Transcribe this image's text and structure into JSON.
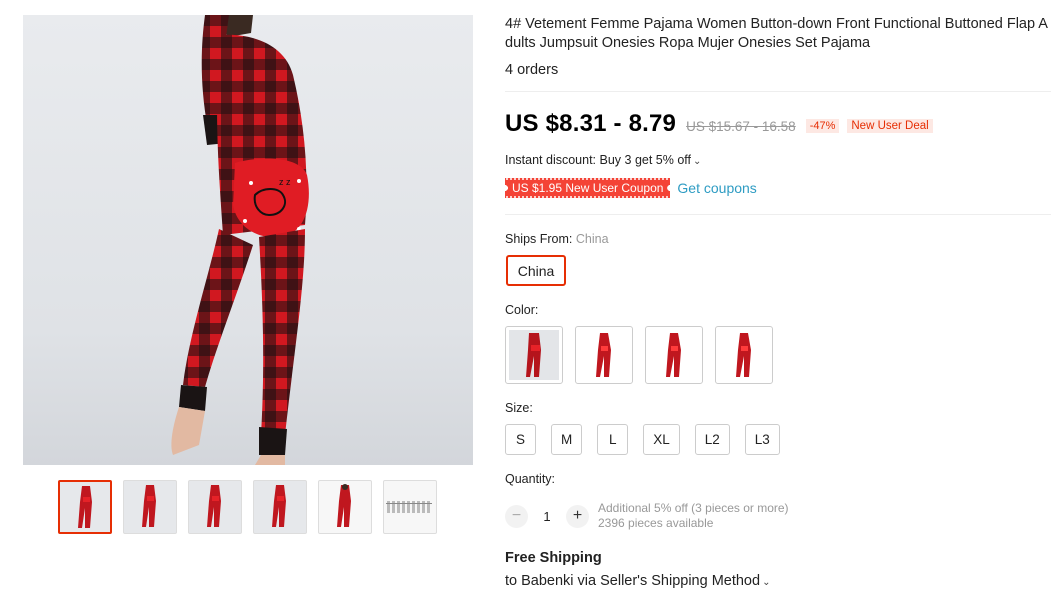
{
  "product": {
    "title": "4# Vetement Femme Pajama Women Button-down Front Functional Buttoned Flap A\ndults Jumpsuit Onesies Ropa Mujer Onesies Set Pajama",
    "orders": "4 orders"
  },
  "pricing": {
    "price": "US $8.31 - 8.79",
    "original": "US $15.67 - 16.58",
    "discount": "-47%",
    "deal": "New User Deal",
    "instant_discount": "Instant discount: Buy 3 get 5% off"
  },
  "coupon": {
    "label": "US $1.95 New User Coupon",
    "link": "Get coupons"
  },
  "ships_from": {
    "label": "Ships From:",
    "value": "China",
    "option": "China"
  },
  "color": {
    "label": "Color:",
    "options": [
      "pajama-back-gray",
      "pajama-front-1",
      "pajama-front-2",
      "pajama-front-3"
    ]
  },
  "size": {
    "label": "Size:",
    "options": [
      "S",
      "M",
      "L",
      "XL",
      "L2",
      "L3"
    ]
  },
  "quantity": {
    "label": "Quantity:",
    "value": "1",
    "minus": "−",
    "plus": "+",
    "note1": "Additional 5% off (3 pieces or more)",
    "note2": "2396 pieces available"
  },
  "shipping": {
    "title": "Free Shipping",
    "method": "to Babenki via Seller's Shipping Method"
  },
  "colors": {
    "accent": "#e62e04",
    "link": "#2e9cc3",
    "coupon": "#f44336"
  }
}
